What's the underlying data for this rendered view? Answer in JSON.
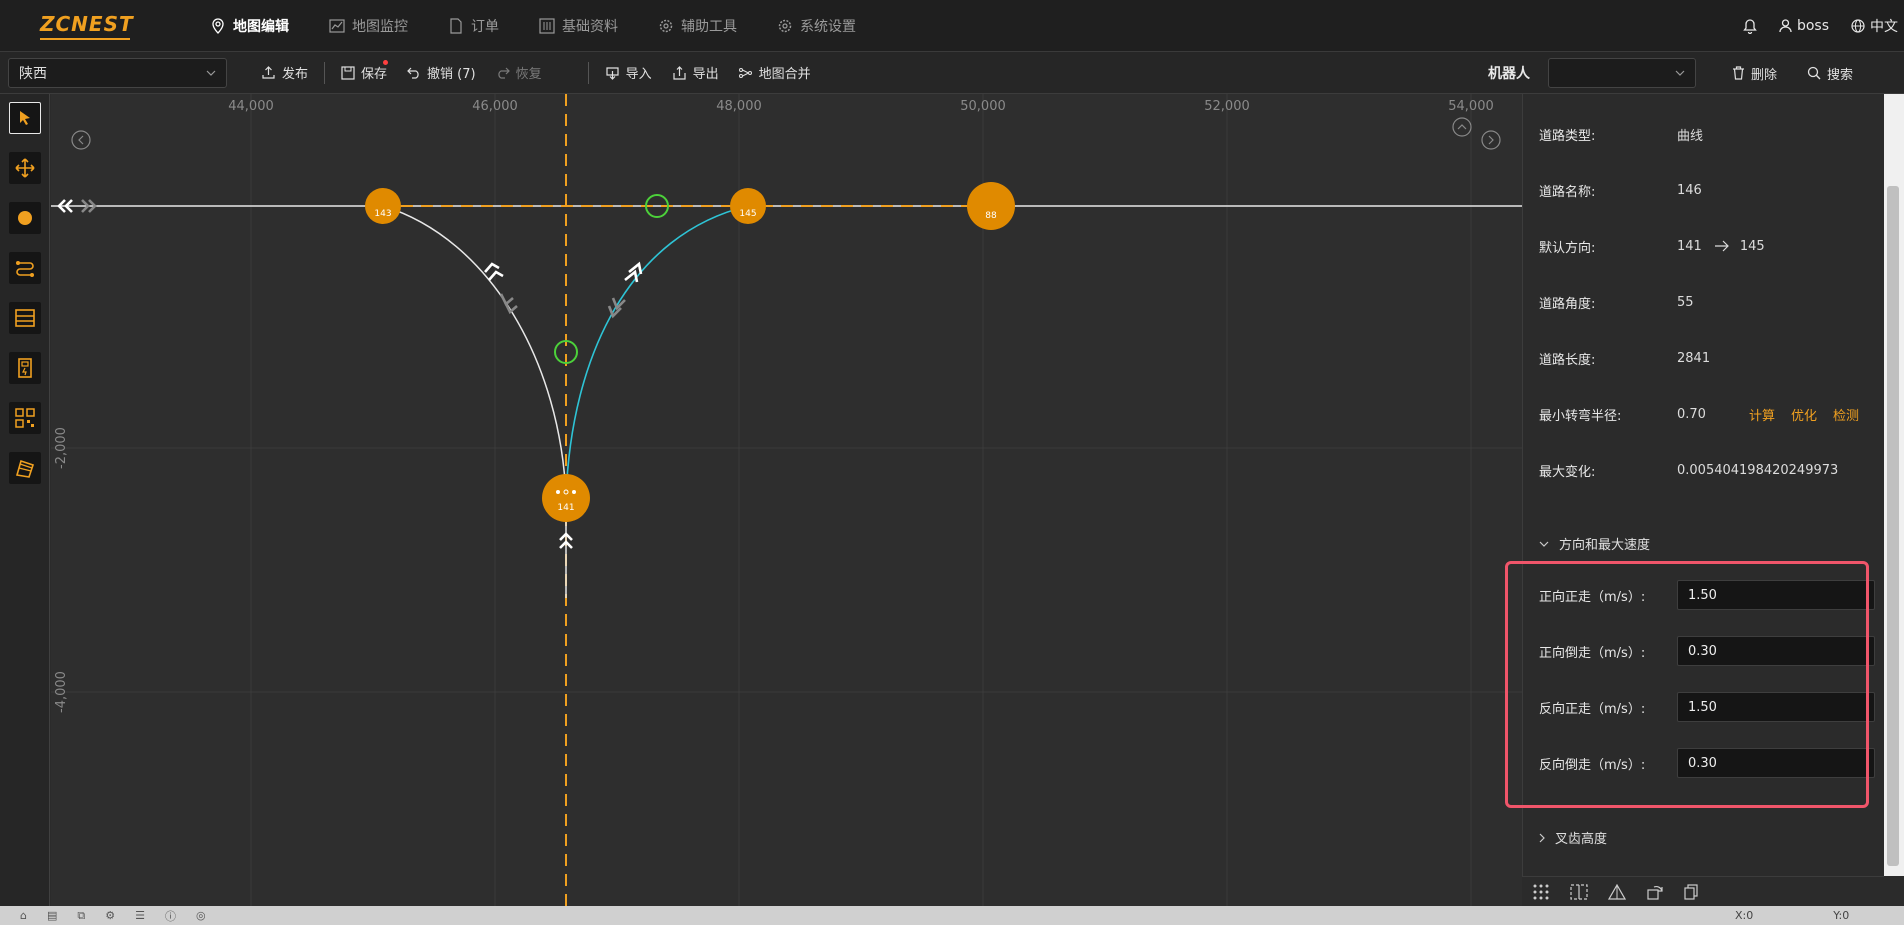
{
  "app": {
    "logo": "ZCNEST"
  },
  "nav": [
    {
      "label": "地图编辑",
      "icon": "map-pin-icon",
      "active": true
    },
    {
      "label": "地图监控",
      "icon": "chart-line-icon",
      "active": false
    },
    {
      "label": "订单",
      "icon": "document-icon",
      "active": false
    },
    {
      "label": "基础资料",
      "icon": "sliders-icon",
      "active": false
    },
    {
      "label": "辅助工具",
      "icon": "gear-icon",
      "active": false
    },
    {
      "label": "系统设置",
      "icon": "gear-icon",
      "active": false
    }
  ],
  "user": {
    "name": "boss",
    "lang": "中文"
  },
  "toolbar": {
    "region": "陕西",
    "publish": "发布",
    "save": "保存",
    "undo": "撤销 (7)",
    "redo": "恢复",
    "import": "导入",
    "export": "导出",
    "merge": "地图合并",
    "robot_label": "机器人",
    "robot_value": "",
    "delete": "删除",
    "search": "搜索"
  },
  "canvas": {
    "x_ticks": [
      "44,000",
      "46,000",
      "48,000",
      "50,000",
      "52,000",
      "54,000"
    ],
    "y_ticks": [
      "-2,000",
      "-4,000"
    ],
    "nodes": [
      {
        "id": "143",
        "label": "143"
      },
      {
        "id": "145",
        "label": "145"
      },
      {
        "id": "88",
        "label": "88"
      },
      {
        "id": "141",
        "label": "141"
      }
    ]
  },
  "panel": {
    "road_type_label": "道路类型:",
    "road_type": "曲线",
    "road_name_label": "道路名称:",
    "road_name": "146",
    "dir_label": "默认方向:",
    "dir_from": "141",
    "dir_to": "145",
    "angle_label": "道路角度:",
    "angle": "55",
    "length_label": "道路长度:",
    "length": "2841",
    "radius_label": "最小转弯半径:",
    "radius": "0.70",
    "calc": "计算",
    "optimize": "优化",
    "detect": "检测",
    "maxchange_label": "最大变化:",
    "maxchange": "0.005404198420249973",
    "section_speed": "方向和最大速度",
    "fwd_fwd_label": "正向正走（m/s）:",
    "fwd_fwd": "1.50",
    "fwd_back_label": "正向倒走（m/s）:",
    "fwd_back": "0.30",
    "rev_fwd_label": "反向正走（m/s）:",
    "rev_fwd": "1.50",
    "rev_back_label": "反向倒走（m/s）:",
    "rev_back": "0.30",
    "section_fork": "叉齿高度"
  },
  "status": {
    "x": "X:0",
    "y": "Y:0"
  },
  "colors": {
    "accent": "#f0a020",
    "highlight": "#f0556a",
    "teal": "#2ec4d6",
    "green": "#4cd13a"
  }
}
